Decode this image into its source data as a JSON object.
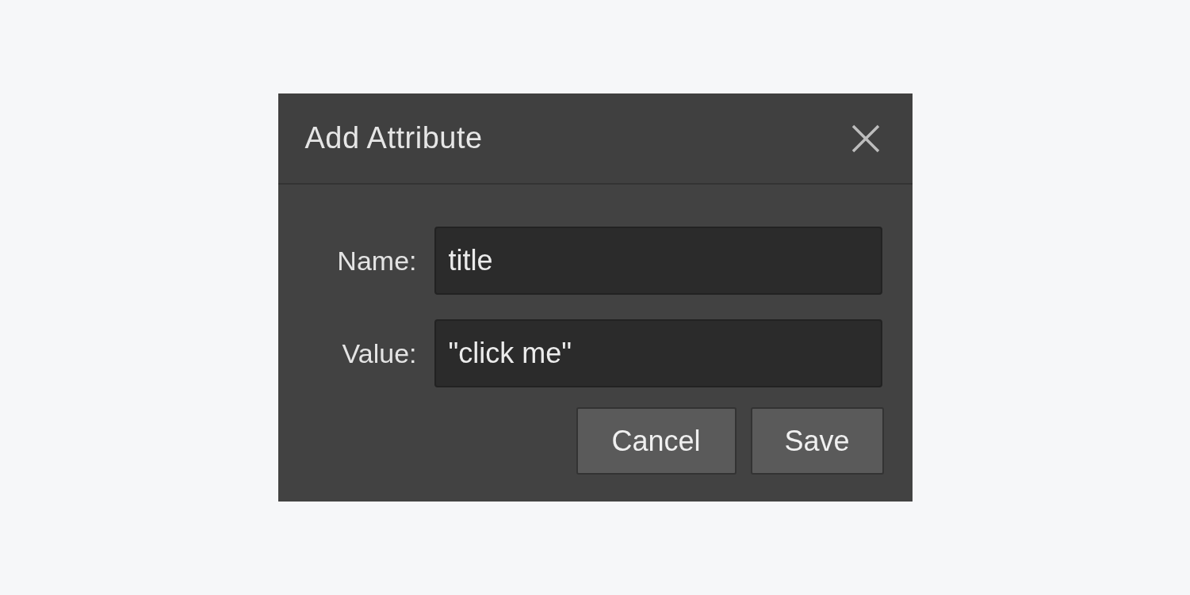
{
  "dialog": {
    "title": "Add Attribute",
    "fields": [
      {
        "label": "Name:",
        "value": "title"
      },
      {
        "label": "Value:",
        "value": "\"click me\""
      }
    ],
    "buttons": [
      "Cancel",
      "Save"
    ]
  }
}
